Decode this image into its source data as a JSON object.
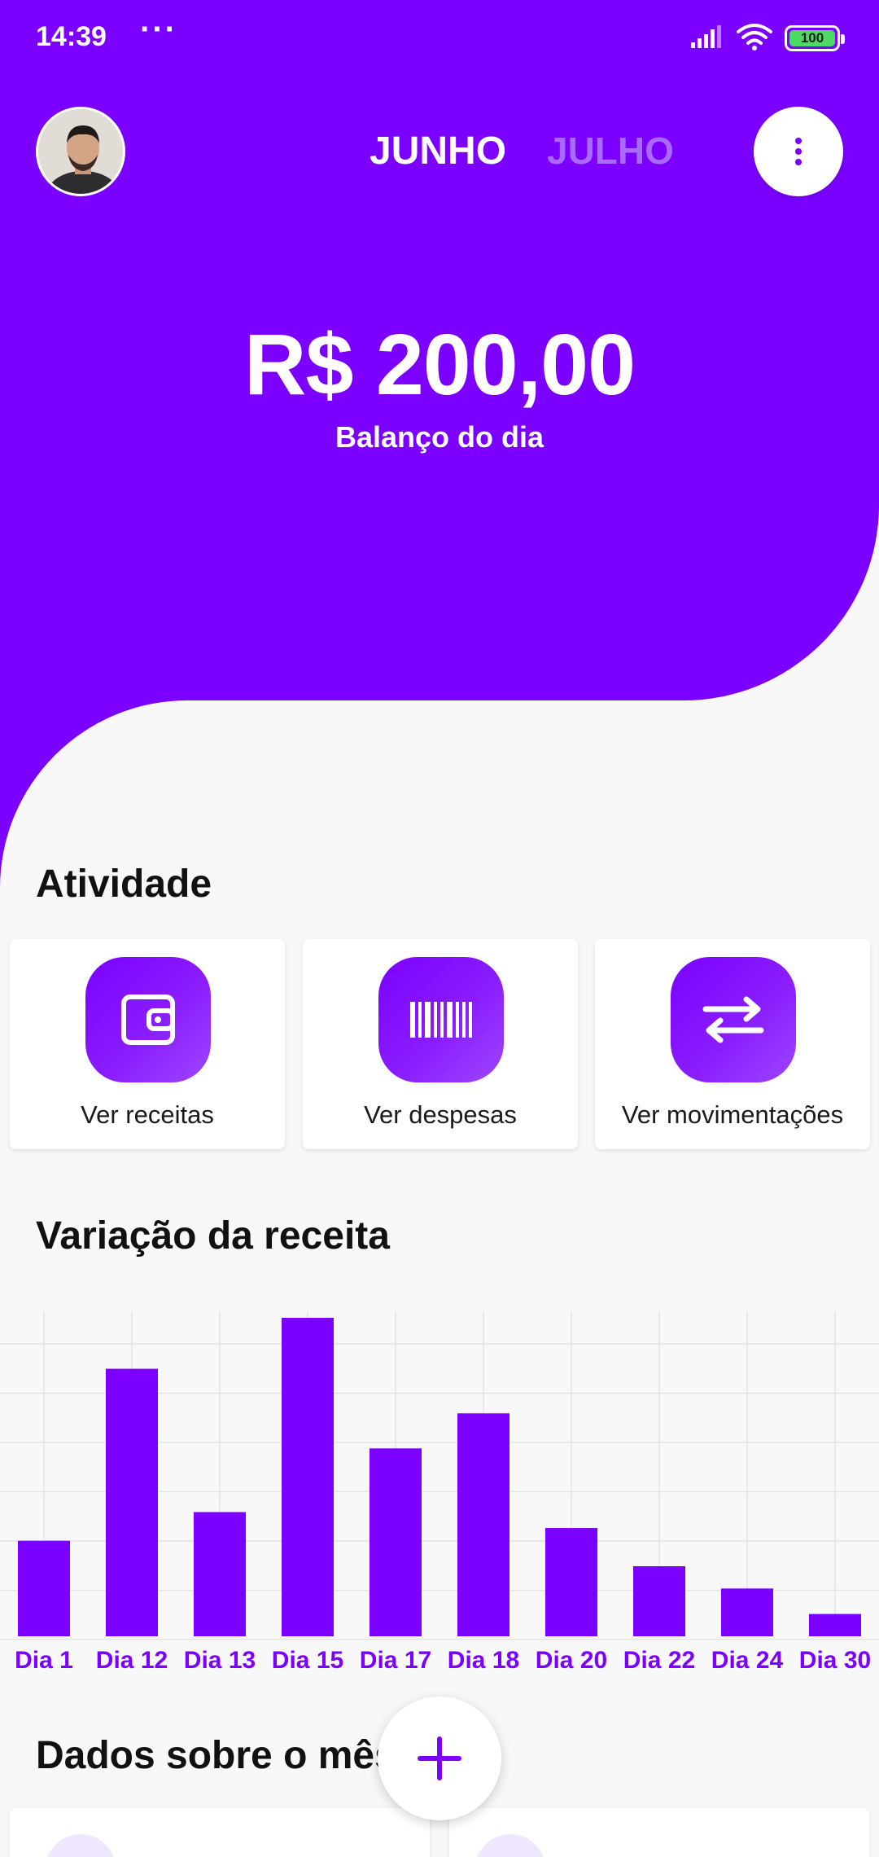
{
  "status_bar": {
    "time": "14:39",
    "battery": "100"
  },
  "header": {
    "month_current": "JUNHO",
    "month_next": "JULHO"
  },
  "balance": {
    "amount": "R$ 200,00",
    "label": "Balanço do dia"
  },
  "activity": {
    "title": "Atividade",
    "cards": [
      {
        "label": "Ver receitas",
        "icon": "wallet-icon"
      },
      {
        "label": "Ver despesas",
        "icon": "barcode-icon"
      },
      {
        "label": "Ver movimentações",
        "icon": "transfer-arrows-icon"
      }
    ]
  },
  "revenue_chart": {
    "title": "Variação da receita"
  },
  "chart_data": {
    "type": "bar",
    "categories": [
      "Dia 1",
      "Dia 12",
      "Dia 13",
      "Dia 15",
      "Dia 17",
      "Dia 18",
      "Dia 20",
      "Dia 22",
      "Dia 24",
      "Dia 30"
    ],
    "values": [
      30,
      84,
      39,
      100,
      59,
      70,
      34,
      22,
      15,
      7
    ],
    "ylim": [
      0,
      100
    ],
    "grid": true,
    "color": "#7b00ff"
  },
  "month_data": {
    "title": "Dados sobre o mês"
  },
  "colors": {
    "primary": "#7b00ff",
    "background": "#f8f8f9"
  }
}
